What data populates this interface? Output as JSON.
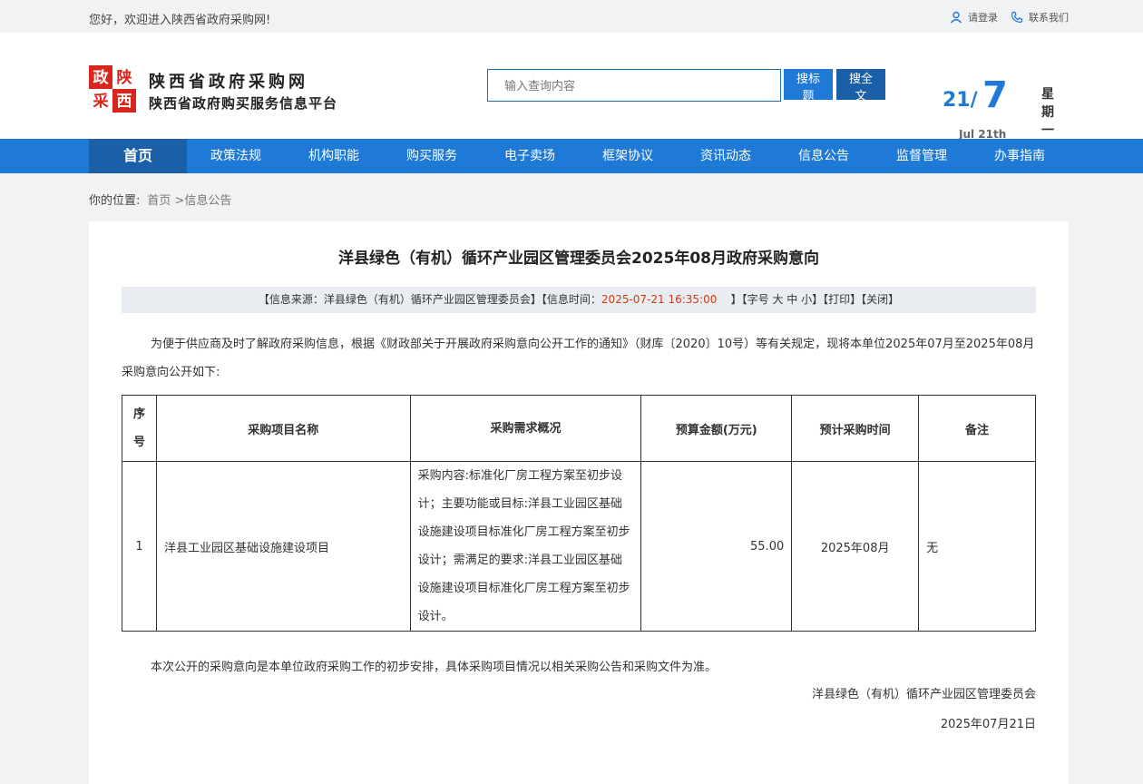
{
  "topbar": {
    "welcome": "您好，欢迎进入陕西省政府采购网!",
    "login": "请登录",
    "contact": "联系我们"
  },
  "header": {
    "logo_text": "陕西 政府 采购",
    "site_title": "陕西省政府采购网",
    "site_sub": "陕西省政府购买服务信息平台",
    "search_placeholder": "输入查询内容",
    "btn_title": "搜标题",
    "btn_full": "搜全文",
    "date_day": "21/",
    "date_month": "7",
    "date_en": "Jul 21th",
    "weekday": "星期一"
  },
  "nav": {
    "items": [
      "首页",
      "政策法规",
      "机构职能",
      "购买服务",
      "电子卖场",
      "框架协议",
      "资讯动态",
      "信息公告",
      "监督管理",
      "办事指南"
    ]
  },
  "breadcrumb": {
    "label": "你的位置:",
    "path": "首页 >信息公告"
  },
  "article": {
    "title": "洋县绿色（有机）循环产业园区管理委员会2025年08月政府采购意向",
    "meta_source": "【信息来源：洋县绿色（有机）循环产业园区管理委员会】【信息时间：",
    "meta_time": "2025-07-21 16:35:00",
    "meta_tail": "】【字号 大 中 小】【打印】【关闭】",
    "intro": "为便于供应商及时了解政府采购信息，根据《财政部关于开展政府采购意向公开工作的通知》（财库〔2020〕10号）等有关规定，现将本单位2025年07月至2025年08月采购意向公开如下:",
    "table": {
      "headers": [
        "序号",
        "采购项目名称",
        "采购需求概况",
        "预算金额(万元)",
        "预计采购时间",
        "备注"
      ],
      "rows": [
        [
          "1",
          "洋县工业园区基础设施建设项目",
          "采购内容:标准化厂房工程方案至初步设计；主要功能或目标:洋县工业园区基础设施建设项目标准化厂房工程方案至初步设计；需满足的要求:洋县工业园区基础设施建设项目标准化厂房工程方案至初步设计。",
          "55.00",
          "2025年08月",
          "无"
        ]
      ]
    },
    "note": "本次公开的采购意向是本单位政府采购工作的初步安排，具体采购项目情况以相关采购公告和采购文件为准。",
    "signature": "洋县绿色（有机）循环产业园区管理委员会",
    "sign_date": "2025年07月21日"
  },
  "colors": {
    "primary": "#1e7ad6",
    "nav_active": "#1a5fa8",
    "logo_red": "#d8261c",
    "time_red": "#d23a0f"
  }
}
